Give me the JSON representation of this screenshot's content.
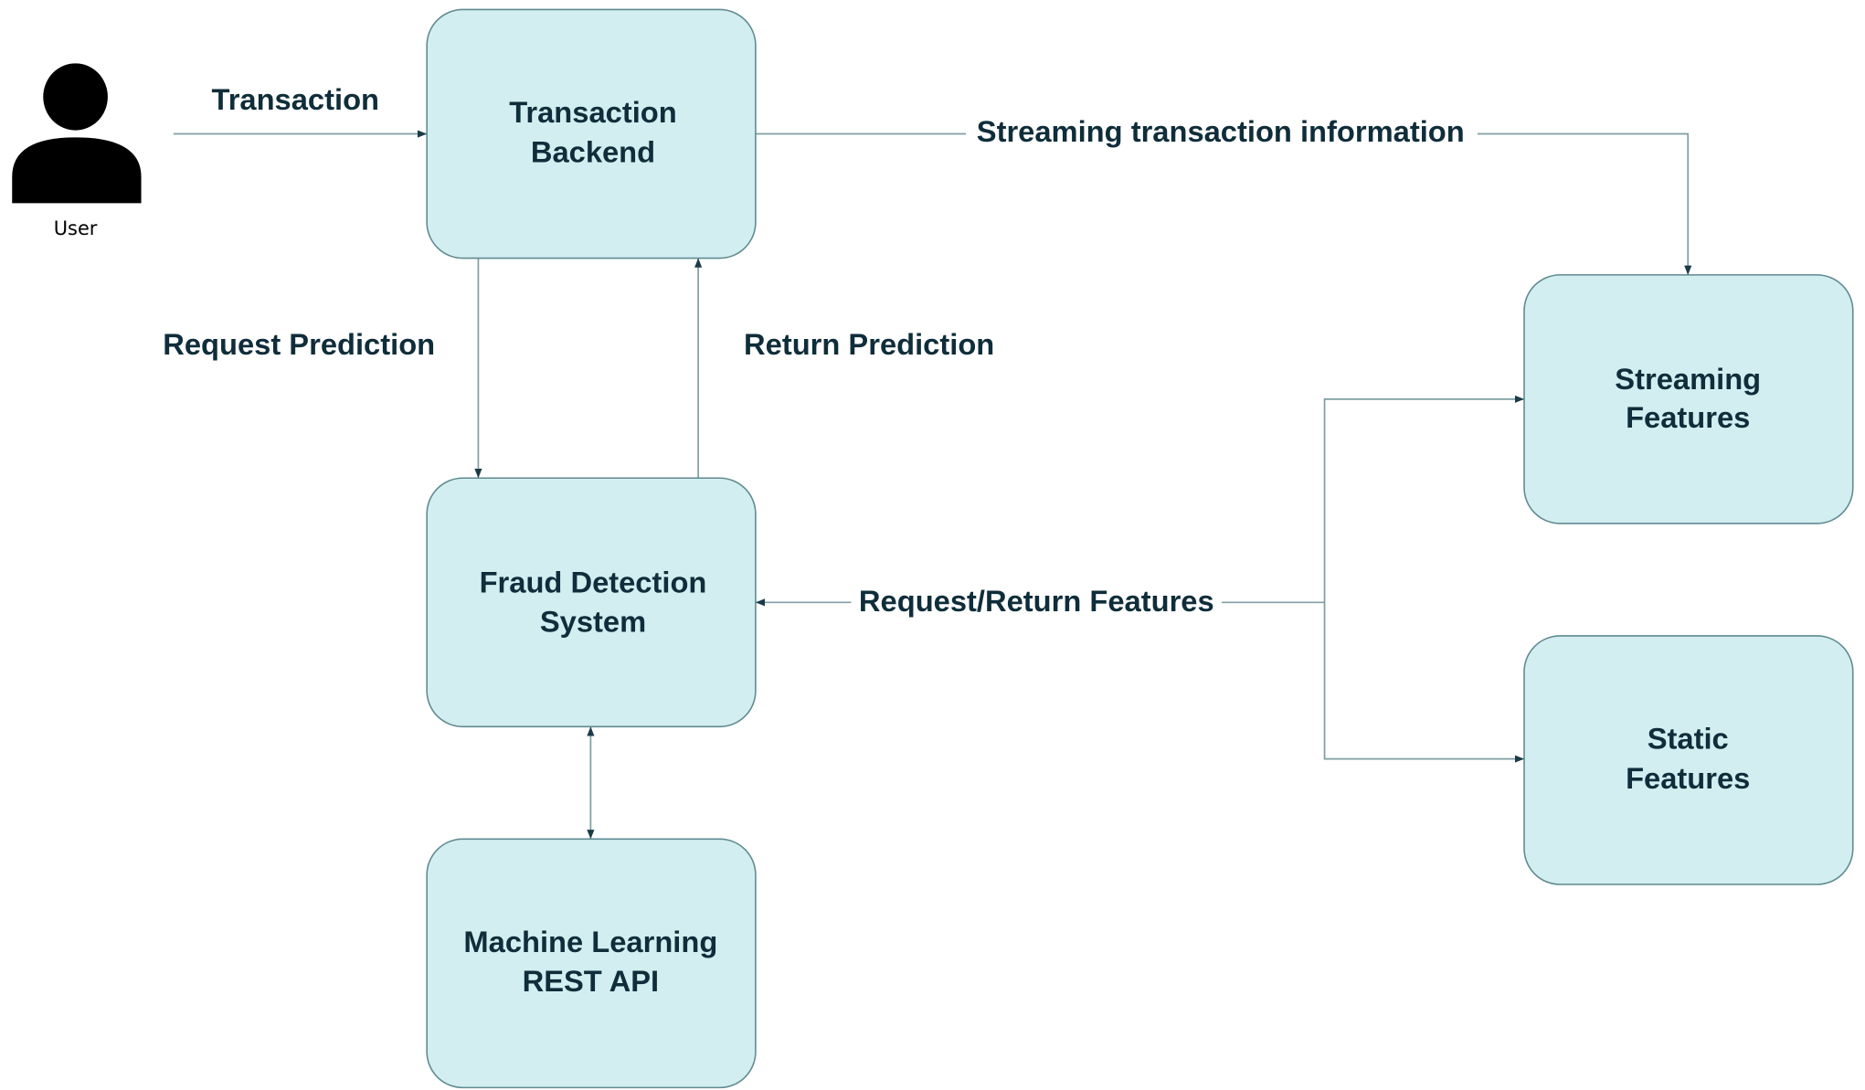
{
  "colors": {
    "box_fill": "#d3eef0",
    "box_stroke": "#5f8a90",
    "connector": "#7f9ea4",
    "arrowhead": "#1b3b48",
    "text": "#0f2d3a"
  },
  "actor": {
    "label": "User",
    "icon": "user-icon"
  },
  "nodes": {
    "transaction_backend": [
      "Transaction",
      "Backend"
    ],
    "fraud_detection": [
      "Fraud Detection",
      "System"
    ],
    "ml_api": [
      "Machine Learning",
      "REST API"
    ],
    "streaming_features": [
      "Streaming",
      "Features"
    ],
    "static_features": [
      "Static",
      "Features"
    ]
  },
  "edges": {
    "transaction": "Transaction",
    "streaming_info": "Streaming transaction information",
    "request_prediction": "Request Prediction",
    "return_prediction": "Return Prediction",
    "request_return_features": "Request/Return Features"
  }
}
